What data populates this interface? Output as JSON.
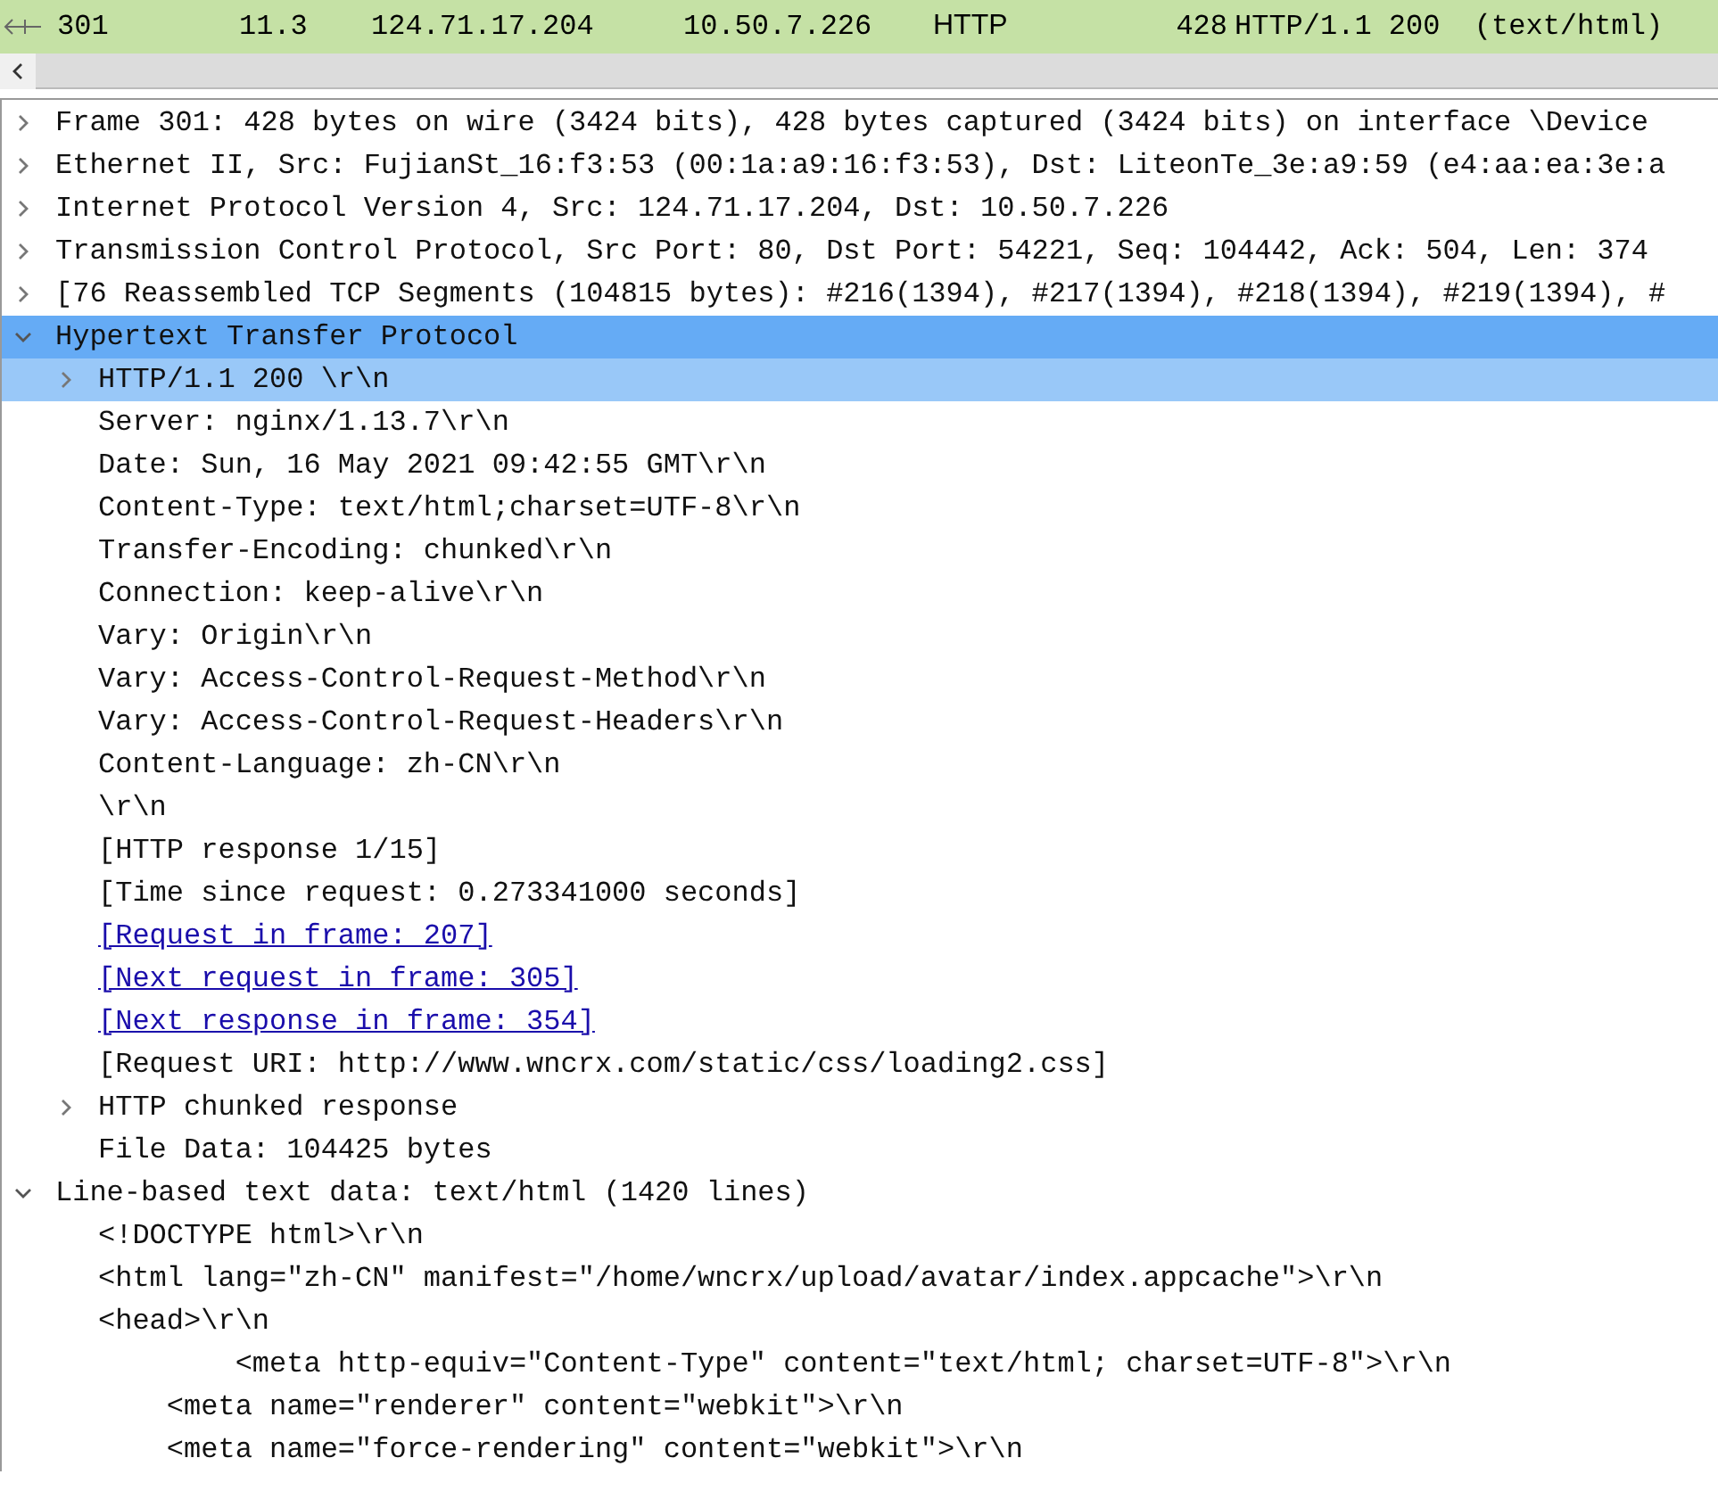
{
  "packet_list": {
    "rows": [
      {
        "no": "301",
        "time": "11.3",
        "source": "124.71.17.204",
        "destination": "10.50.7.226",
        "protocol": "HTTP",
        "length": "428",
        "info": "HTTP/1.1 200  (text/html)",
        "selected": true
      }
    ]
  },
  "details": [
    {
      "text": "Frame 301: 428 bytes on wire (3424 bits), 428 bytes captured (3424 bits) on interface \\Device",
      "expandable": true,
      "expanded": false,
      "selected": false
    },
    {
      "text": "Ethernet II, Src: FujianSt_16:f3:53 (00:1a:a9:16:f3:53), Dst: LiteonTe_3e:a9:59 (e4:aa:ea:3e:a",
      "expandable": true,
      "expanded": false,
      "selected": false
    },
    {
      "text": "Internet Protocol Version 4, Src: 124.71.17.204, Dst: 10.50.7.226",
      "expandable": true,
      "expanded": false,
      "selected": false
    },
    {
      "text": "Transmission Control Protocol, Src Port: 80, Dst Port: 54221, Seq: 104442, Ack: 504, Len: 374",
      "expandable": true,
      "expanded": false,
      "selected": false
    },
    {
      "text": "[76 Reassembled TCP Segments (104815 bytes): #216(1394), #217(1394), #218(1394), #219(1394), #",
      "expandable": true,
      "expanded": false,
      "selected": false
    },
    {
      "text": "Hypertext Transfer Protocol",
      "expandable": true,
      "expanded": true,
      "selected": true,
      "children": [
        {
          "text": "HTTP/1.1 200 \\r\\n",
          "expandable": true,
          "expanded": false,
          "selected": true
        },
        {
          "text": "Server: nginx/1.13.7\\r\\n",
          "expandable": false,
          "selected": false
        },
        {
          "text": "Date: Sun, 16 May 2021 09:42:55 GMT\\r\\n",
          "expandable": false,
          "selected": false
        },
        {
          "text": "Content-Type: text/html;charset=UTF-8\\r\\n",
          "expandable": false,
          "selected": false
        },
        {
          "text": "Transfer-Encoding: chunked\\r\\n",
          "expandable": false,
          "selected": false
        },
        {
          "text": "Connection: keep-alive\\r\\n",
          "expandable": false,
          "selected": false
        },
        {
          "text": "Vary: Origin\\r\\n",
          "expandable": false,
          "selected": false
        },
        {
          "text": "Vary: Access-Control-Request-Method\\r\\n",
          "expandable": false,
          "selected": false
        },
        {
          "text": "Vary: Access-Control-Request-Headers\\r\\n",
          "expandable": false,
          "selected": false
        },
        {
          "text": "Content-Language: zh-CN\\r\\n",
          "expandable": false,
          "selected": false
        },
        {
          "text": "\\r\\n",
          "expandable": false,
          "selected": false
        },
        {
          "text": "[HTTP response 1/15]",
          "expandable": false,
          "selected": false
        },
        {
          "text": "[Time since request: 0.273341000 seconds]",
          "expandable": false,
          "selected": false
        },
        {
          "text": "[Request in frame: 207]",
          "kind": "link",
          "expandable": false,
          "selected": false
        },
        {
          "text": "[Next request in frame: 305]",
          "kind": "link",
          "expandable": false,
          "selected": false
        },
        {
          "text": "[Next response in frame: 354]",
          "kind": "link",
          "expandable": false,
          "selected": false
        },
        {
          "text": "[Request URI: http://www.wncrx.com/static/css/loading2.css]",
          "expandable": false,
          "selected": false
        },
        {
          "text": "HTTP chunked response",
          "expandable": true,
          "expanded": false,
          "selected": false
        },
        {
          "text": "File Data: 104425 bytes",
          "expandable": false,
          "selected": false
        }
      ]
    },
    {
      "text": "Line-based text data: text/html (1420 lines)",
      "expandable": true,
      "expanded": true,
      "selected": false,
      "children": [
        {
          "text": "<!DOCTYPE html>\\r\\n",
          "expandable": false,
          "selected": false
        },
        {
          "text": "<html lang=\"zh-CN\" manifest=\"/home/wncrx/upload/avatar/index.appcache\">\\r\\n",
          "expandable": false,
          "selected": false
        },
        {
          "text": "<head>\\r\\n",
          "expandable": false,
          "selected": false
        },
        {
          "text": "        <meta http-equiv=\"Content-Type\" content=\"text/html; charset=UTF-8\">\\r\\n",
          "expandable": false,
          "selected": false
        },
        {
          "text": "    <meta name=\"renderer\" content=\"webkit\">\\r\\n",
          "expandable": false,
          "selected": false
        },
        {
          "text": "    <meta name=\"force-rendering\" content=\"webkit\">\\r\\n",
          "expandable": false,
          "selected": false
        }
      ]
    }
  ]
}
